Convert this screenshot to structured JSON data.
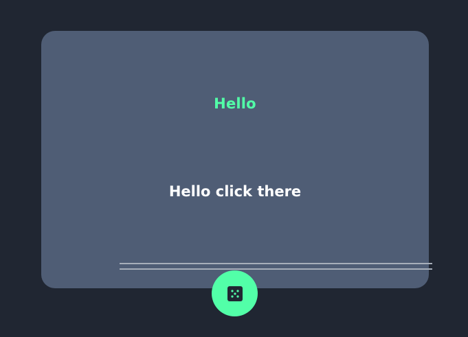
{
  "card": {
    "heading": "Hello",
    "message": "Hello click there"
  },
  "dice_button": {
    "icon": "dice-icon"
  },
  "colors": {
    "background": "#202632",
    "card": "#4f5d75",
    "accent": "#52ffa8",
    "text": "#ffffff",
    "divider": "#a7afba"
  }
}
